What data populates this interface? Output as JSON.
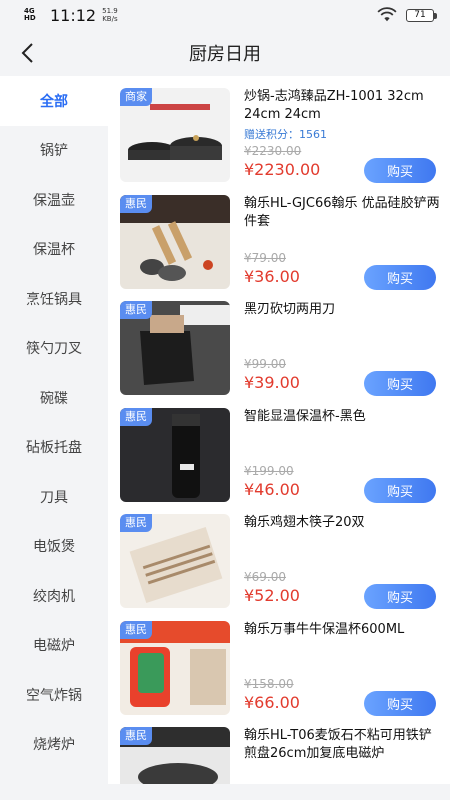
{
  "status": {
    "network": "4G HD",
    "time": "11:12",
    "speed_value": "51.9",
    "speed_unit": "KB/s",
    "battery": "71"
  },
  "header": {
    "title": "厨房日用"
  },
  "sidebar": {
    "items": [
      {
        "label": "全部",
        "active": true
      },
      {
        "label": "锅铲"
      },
      {
        "label": "保温壶"
      },
      {
        "label": "保温杯"
      },
      {
        "label": "烹饪锅具"
      },
      {
        "label": "筷勺刀叉"
      },
      {
        "label": "碗碟"
      },
      {
        "label": "砧板托盘"
      },
      {
        "label": "刀具"
      },
      {
        "label": "电饭煲"
      },
      {
        "label": "绞肉机"
      },
      {
        "label": "电磁炉"
      },
      {
        "label": "空气炸锅"
      },
      {
        "label": "烧烤炉"
      }
    ]
  },
  "products": [
    {
      "badge": "商家",
      "title": "炒锅-志鸿臻品ZH-1001 32cm 24cm 24cm",
      "points_label": "赠送积分：",
      "points": "1561",
      "original_price": "¥2230.00",
      "price": "¥2230.00",
      "buy_label": "购买"
    },
    {
      "badge": "惠民",
      "title": "翰乐HL-GJC66翰乐 优品硅胶铲两件套",
      "original_price": "¥79.00",
      "price": "¥36.00",
      "buy_label": "购买"
    },
    {
      "badge": "惠民",
      "title": "黑刃砍切两用刀",
      "original_price": "¥99.00",
      "price": "¥39.00",
      "buy_label": "购买"
    },
    {
      "badge": "惠民",
      "title": "智能显温保温杯-黑色",
      "original_price": "¥199.00",
      "price": "¥46.00",
      "buy_label": "购买"
    },
    {
      "badge": "惠民",
      "title": "翰乐鸡翅木筷子20双",
      "original_price": "¥69.00",
      "price": "¥52.00",
      "buy_label": "购买"
    },
    {
      "badge": "惠民",
      "title": "翰乐万事牛牛保温杯600ML",
      "original_price": "¥158.00",
      "price": "¥66.00",
      "buy_label": "购买"
    },
    {
      "badge": "惠民",
      "title": "翰乐HL-T06麦饭石不粘可用铁铲煎盘26cm加复底电磁炉"
    }
  ],
  "colors": {
    "accent": "#2a6df4",
    "price": "#e23b2e",
    "badge": "#5a8df0"
  }
}
